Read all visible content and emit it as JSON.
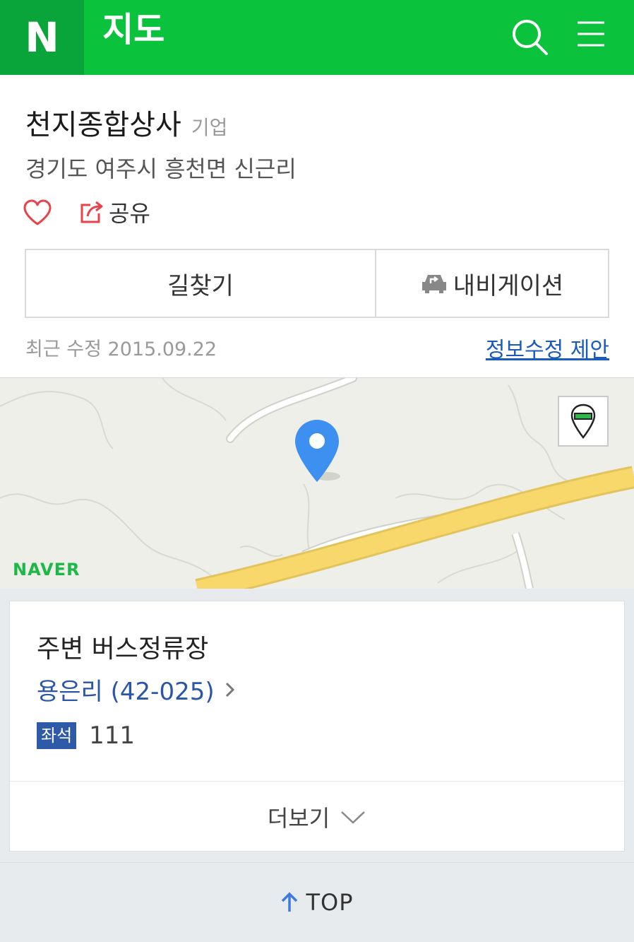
{
  "header": {
    "logo": "N",
    "title": "지도",
    "brand_color": "#0bc23c"
  },
  "place": {
    "name": "천지종합상사",
    "category": "기업",
    "address": "경기도 여주시 흥천면 신근리",
    "share_label": "공유",
    "route_label": "길찾기",
    "navigation_label": "내비게이션",
    "updated": "최근 수정 2015.09.22",
    "suggest_edit": "정보수정 제안"
  },
  "map": {
    "logo": "NAVER"
  },
  "bus": {
    "title": "주변 버스정류장",
    "stop_name": "용은리 (42-025)",
    "seat_badge": "좌석",
    "route_number": "111",
    "more_label": "더보기"
  },
  "footer": {
    "top_label": "TOP"
  }
}
